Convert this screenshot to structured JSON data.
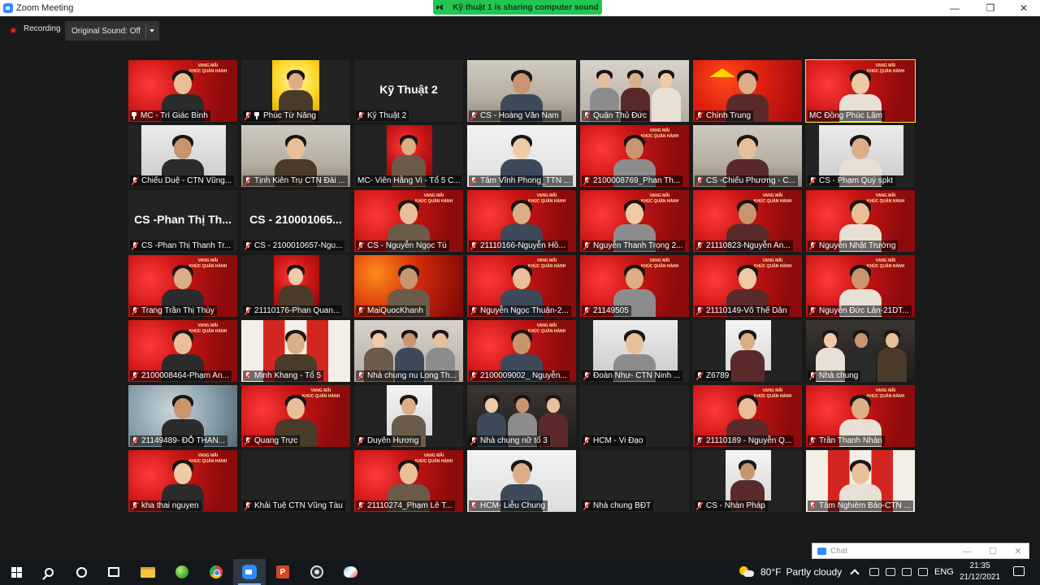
{
  "window": {
    "title": "Zoom Meeting",
    "minimize": "—",
    "maximize": "❐",
    "close": "✕"
  },
  "sharing_banner": "Kỹ thuật 1 is sharing computer sound",
  "recording": {
    "label": "Recording",
    "sound_button": "Original Sound: Off"
  },
  "banner_text": "VANG MÃI\nKHÚC QUÂN HÀNH",
  "tiles": [
    {
      "name": "MC - Trí Giác Bình",
      "bg": "red",
      "pin": true,
      "mic_muted": false
    },
    {
      "name": "Phúc Từ Năng",
      "bg": "yellow",
      "pin": true,
      "mic_muted": true
    },
    {
      "name": "Kỹ Thuật 2",
      "bg": "none",
      "big_name": "Kỹ Thuật 2",
      "mic_muted": true
    },
    {
      "name": "CS - Hoàng Văn Nam",
      "bg": "room",
      "mic_muted": true
    },
    {
      "name": "Quận Thủ Đức",
      "bg": "group",
      "mic_muted": true
    },
    {
      "name": "Chính Trung",
      "bg": "flag",
      "mic_muted": true
    },
    {
      "name": "MC Đồng Phúc Lâm",
      "bg": "red",
      "mic_muted": false,
      "active": true
    },
    {
      "name": "Chiếu Duệ - CTN Vũng...",
      "bg": "side-light",
      "mic_muted": true
    },
    {
      "name": "Tịnh Kiên Trụ  CTN Đài ...",
      "bg": "room",
      "mic_muted": true
    },
    {
      "name": "MC- Viên Hằng Vi - Tổ 5 C...",
      "bg": "center-red",
      "mic_muted": false
    },
    {
      "name": "Tâm Vĩnh Phong_TTN ...",
      "bg": "light",
      "mic_muted": true
    },
    {
      "name": "2100008769_Phan Th...",
      "bg": "red",
      "mic_muted": true
    },
    {
      "name": "CS -Chiếu Phương - C...",
      "bg": "room",
      "mic_muted": true
    },
    {
      "name": "CS - Phạm Quý spkt",
      "bg": "side-light",
      "mic_muted": true
    },
    {
      "name": "CS -Phan Thị Thanh Tr...",
      "bg": "none",
      "big_name": "CS -Phan Thị Th...",
      "mic_muted": true
    },
    {
      "name": "CS - 2100010657-Ngu...",
      "bg": "none",
      "big_name": "CS - 210001065...",
      "mic_muted": true
    },
    {
      "name": "CS - Nguyễn Ngọc Tú",
      "bg": "red",
      "mic_muted": true
    },
    {
      "name": "21110166-Nguyễn Hồ...",
      "bg": "red",
      "mic_muted": true
    },
    {
      "name": "Nguyễn Thanh Trọng 2...",
      "bg": "red",
      "mic_muted": true
    },
    {
      "name": "21110823-Nguyễn An...",
      "bg": "red",
      "mic_muted": true
    },
    {
      "name": "Nguyễn Nhật Trường",
      "bg": "red",
      "mic_muted": true
    },
    {
      "name": "Trang Trần Thị Thùy",
      "bg": "red",
      "mic_muted": true
    },
    {
      "name": "21110176-Phan Quan...",
      "bg": "center-red",
      "mic_muted": true
    },
    {
      "name": "MaiQuocKhanh",
      "bg": "fire",
      "mic_muted": true
    },
    {
      "name": "Nguyễn Ngọc Thuận-2...",
      "bg": "red",
      "mic_muted": true
    },
    {
      "name": "21149505",
      "bg": "red",
      "mic_muted": true
    },
    {
      "name": "21110149-Võ Thế Dân",
      "bg": "red",
      "mic_muted": true
    },
    {
      "name": "Nguyễn Đức Lân-21DT...",
      "bg": "red",
      "mic_muted": true
    },
    {
      "name": "2100008464-Phạm An...",
      "bg": "red",
      "mic_muted": true
    },
    {
      "name": "Minh Khang - Tổ 5",
      "bg": "poster",
      "mic_muted": true
    },
    {
      "name": "Nhà chung nu Long Th...",
      "bg": "group",
      "mic_muted": true
    },
    {
      "name": "2100009002_ Nguyễn...",
      "bg": "red",
      "mic_muted": true
    },
    {
      "name": "Đoàn Như- CTN Ninh ...",
      "bg": "side-light",
      "mic_muted": true
    },
    {
      "name": "Z6789",
      "bg": "center-light",
      "mic_muted": true
    },
    {
      "name": "Nhà chung",
      "bg": "dark",
      "mic_muted": true
    },
    {
      "name": "21149489- ĐỖ THAN...",
      "bg": "blur",
      "mic_muted": true
    },
    {
      "name": "Quang Trực",
      "bg": "red",
      "mic_muted": true
    },
    {
      "name": "Duyên Hương",
      "bg": "center-light",
      "mic_muted": true
    },
    {
      "name": "Nhà chung nữ tổ 3",
      "bg": "dark",
      "mic_muted": true
    },
    {
      "name": "HCM - Vi Đạo",
      "bg": "none",
      "mic_muted": true
    },
    {
      "name": "21110189 - Nguyễn Q...",
      "bg": "red",
      "mic_muted": true
    },
    {
      "name": "Trần Thanh Nhàn",
      "bg": "red",
      "mic_muted": true
    },
    {
      "name": "kha thai nguyen",
      "bg": "red",
      "mic_muted": true
    },
    {
      "name": "Khải Tuệ CTN Vũng Tàu",
      "bg": "none",
      "mic_muted": true
    },
    {
      "name": "21110274_Phạm Lê T...",
      "bg": "red",
      "mic_muted": true
    },
    {
      "name": "HCM- Liễu Chung",
      "bg": "light",
      "mic_muted": true
    },
    {
      "name": "Nhà chung BĐT",
      "bg": "none",
      "mic_muted": true
    },
    {
      "name": "CS - Nhàn Pháp",
      "bg": "center-light",
      "mic_muted": true
    },
    {
      "name": "Tâm Nghiêm Bảo-CTN ...",
      "bg": "poster",
      "mic_muted": true
    }
  ],
  "chat": {
    "label": "Chat",
    "minimize": "—",
    "maximize": "☐",
    "close": "✕"
  },
  "taskbar": {
    "weather_temp": "80°F",
    "weather_desc": "Partly cloudy",
    "language": "ENG",
    "time": "21:35",
    "date": "21/12/2021",
    "ppt_letter": "P"
  }
}
